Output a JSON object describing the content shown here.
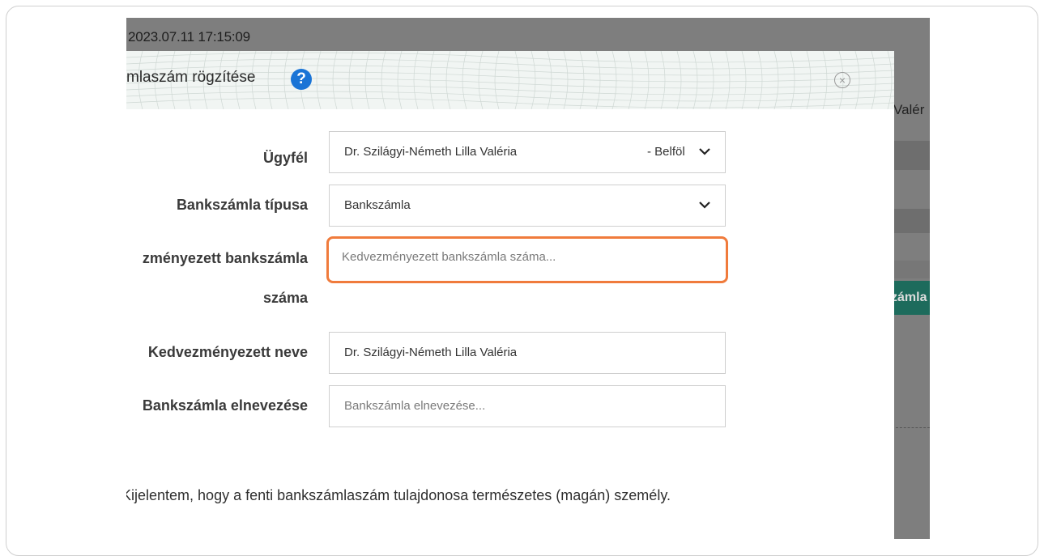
{
  "background": {
    "timestamp": "2023.07.11 17:15:09",
    "right_partial_label": "Valér",
    "right_partial_button": "zámla"
  },
  "dialog": {
    "title": "mlaszám rögzítése",
    "help_icon": "?",
    "close_icon": "×"
  },
  "form": {
    "client_label": "Ügyfél",
    "client_value_left": "Dr. Szilágyi-Németh Lilla Valéria",
    "client_value_right": "- Belföl",
    "account_type_label": "Bankszámla típusa",
    "account_type_value": "Bankszámla",
    "beneficiary_account_label_line1": "zményezett bankszámla",
    "beneficiary_account_label_line2": "száma",
    "beneficiary_account_placeholder": "Kedvezményezett bankszámla száma...",
    "beneficiary_name_label": "Kedvezményezett neve",
    "beneficiary_name_value": "Dr. Szilágyi-Németh Lilla Valéria",
    "account_nickname_label": "Bankszámla elnevezése",
    "account_nickname_placeholder": "Bankszámla elnevezése..."
  },
  "declaration": "Kijelentem, hogy a fenti bankszámlaszám tulajdonosa természetes (magán) személy.",
  "colors": {
    "highlight": "#f07b3c",
    "help_blue": "#1a74d6",
    "green_button": "#1d6b5c"
  }
}
